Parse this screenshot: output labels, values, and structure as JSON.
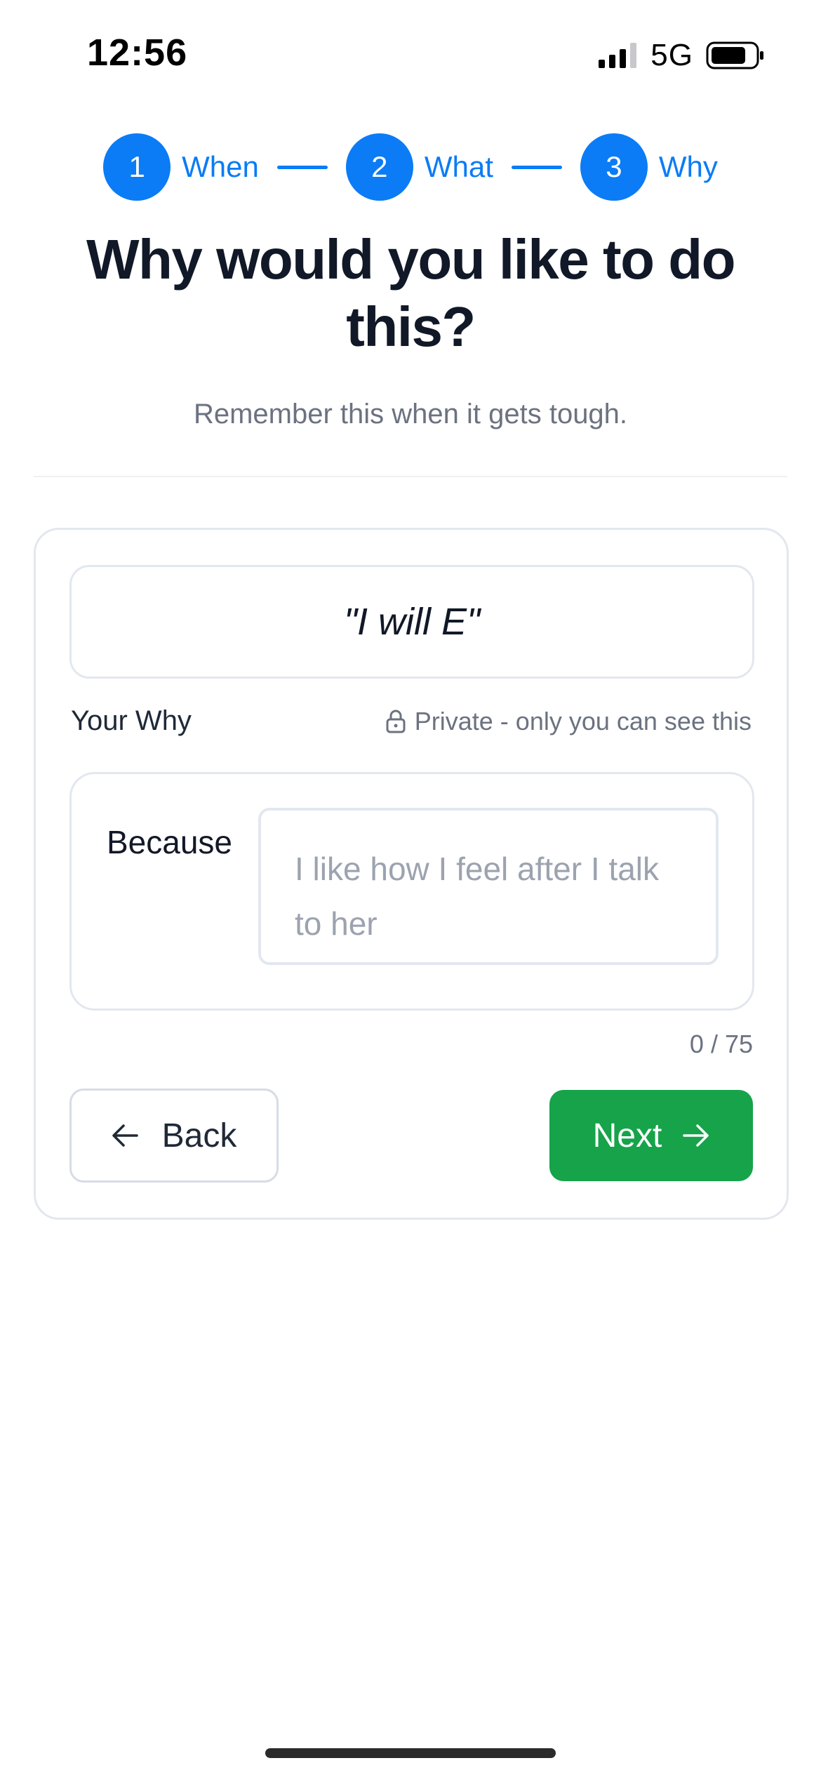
{
  "status_bar": {
    "time": "12:56",
    "network": "5G",
    "icons": [
      "signal-bars-icon",
      "battery-icon"
    ]
  },
  "stepper": {
    "steps": [
      {
        "number": "1",
        "label": "When"
      },
      {
        "number": "2",
        "label": "What"
      },
      {
        "number": "3",
        "label": "Why"
      }
    ],
    "active_color": "#0b7cf5"
  },
  "header": {
    "title": "Why would you like to do this?",
    "subtitle": "Remember this when it gets tough."
  },
  "card": {
    "intention": "\"I will E\"",
    "why_label": "Your Why",
    "private_note": "Private - only you can see this",
    "because_label": "Because",
    "because_value": "",
    "because_placeholder": "I like how I feel after I talk to her",
    "char_count": "0 / 75"
  },
  "actions": {
    "back_label": "Back",
    "next_label": "Next",
    "next_color": "#16a34a"
  }
}
